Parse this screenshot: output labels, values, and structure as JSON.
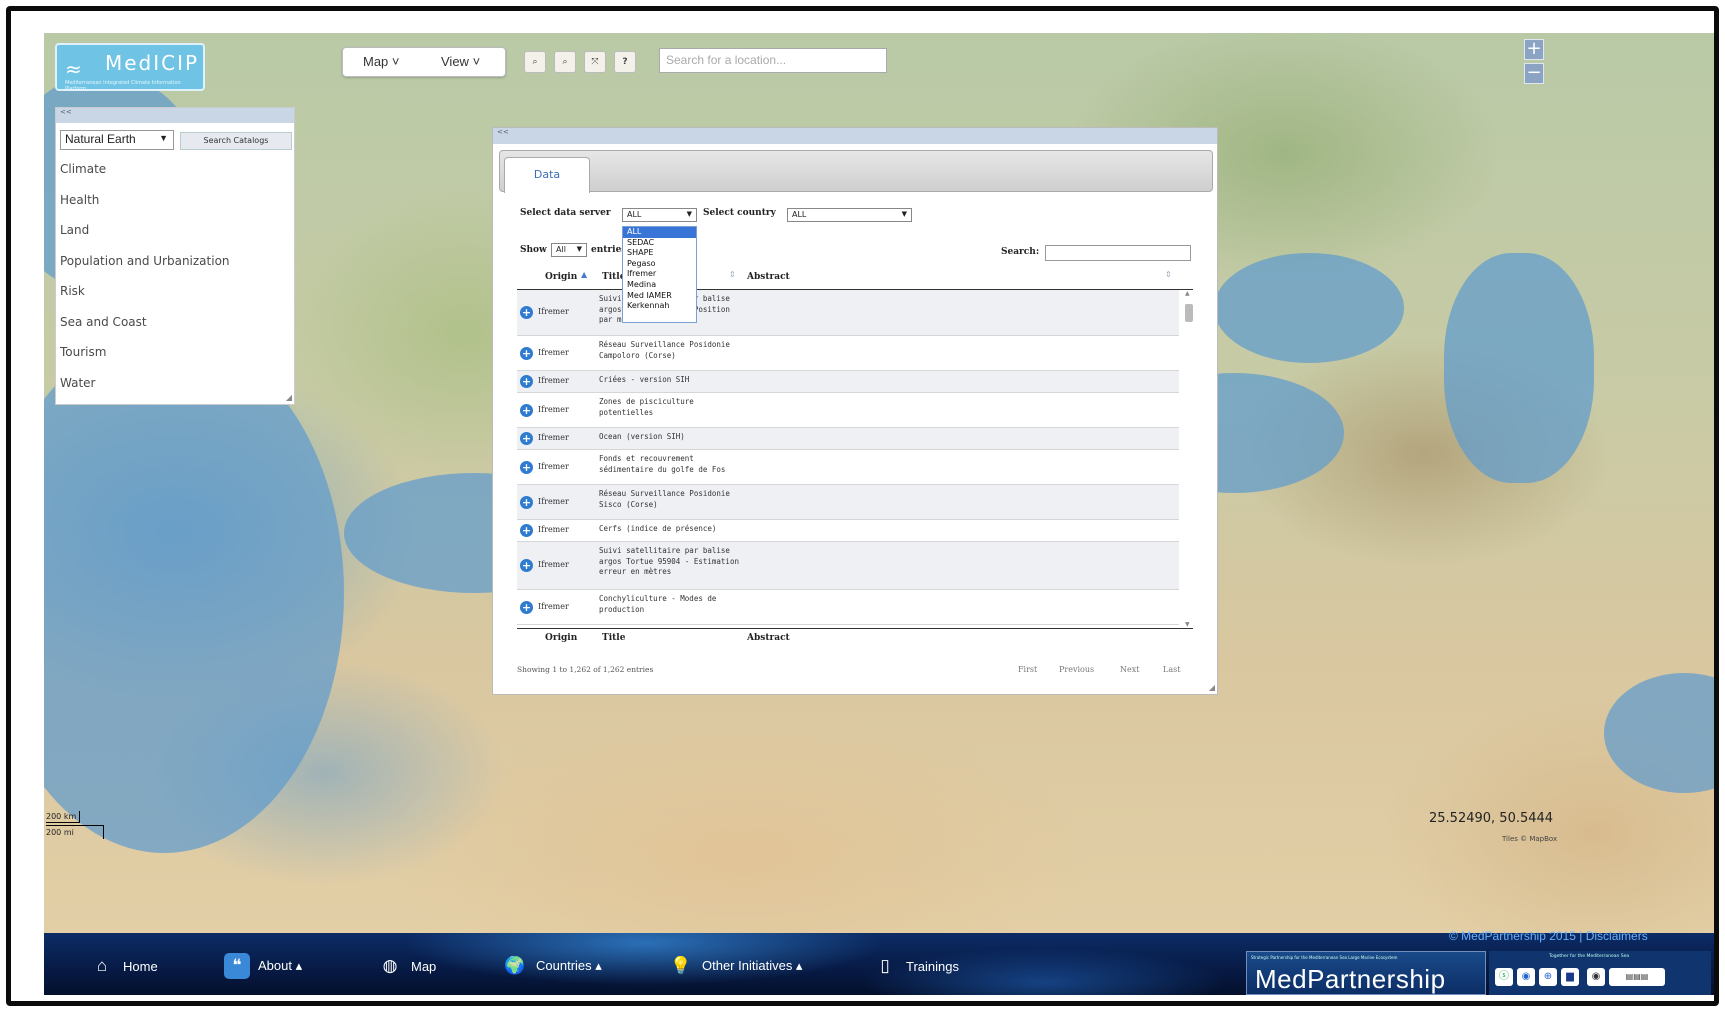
{
  "logo": {
    "name": "MedICIP",
    "tagline": "Mediterranean Integrated Climate Information Platform"
  },
  "toolbar": {
    "menus": [
      {
        "label": "Map"
      },
      {
        "label": "View"
      }
    ],
    "tools": [
      "zoom-in-tool-icon",
      "zoom-out-tool-icon",
      "full-extent-icon",
      "help-icon"
    ],
    "help_label": "?",
    "location_placeholder": "Search for a location..."
  },
  "zoom": {
    "in": "+",
    "out": "−"
  },
  "catalog_panel": {
    "collapse": "<<",
    "selected_source": "Natural Earth",
    "search_button": "Search Catalogs",
    "categories": [
      "Climate",
      "Health",
      "Land",
      "Population and Urbanization",
      "Risk",
      "Sea and Coast",
      "Tourism",
      "Water"
    ]
  },
  "data_panel": {
    "collapse": "<<",
    "tab": "Data",
    "server_label": "Select data server",
    "server_value": "ALL",
    "country_label": "Select country",
    "country_value": "ALL",
    "show_label": "Show",
    "show_value": "All",
    "entries_label": "entries",
    "search_label": "Search:",
    "server_options": [
      "ALL",
      "SEDAC",
      "SHAPE",
      "Pegaso",
      "Ifremer",
      "Medina",
      "Med IAMER",
      "Kerkennah"
    ],
    "columns": [
      "Origin",
      "Title",
      "Abstract"
    ],
    "rows": [
      {
        "origin": "Ifremer",
        "title": "Suivi satellitaire par balise argos Tortue 95904 - Position par mois"
      },
      {
        "origin": "Ifremer",
        "title": "Réseau Surveillance Posidonie Campoloro (Corse)"
      },
      {
        "origin": "Ifremer",
        "title": "Criées - version SIH"
      },
      {
        "origin": "Ifremer",
        "title": "Zones de pisciculture potentielles"
      },
      {
        "origin": "Ifremer",
        "title": "Ocean (version SIH)"
      },
      {
        "origin": "Ifremer",
        "title": "Fonds et recouvrement sédimentaire du golfe de Fos"
      },
      {
        "origin": "Ifremer",
        "title": "Réseau Surveillance Posidonie Sisco (Corse)"
      },
      {
        "origin": "Ifremer",
        "title": "Cerfs (indice de présence)"
      },
      {
        "origin": "Ifremer",
        "title": "Suivi satellitaire par balise argos Tortue 95904 - Estimation erreur en mètres"
      },
      {
        "origin": "Ifremer",
        "title": "Conchyliculture - Modes de production"
      }
    ],
    "info": "Showing 1 to 1,262 of 1,262 entries",
    "pagination": [
      "First",
      "Previous",
      "Next",
      "Last"
    ]
  },
  "scale": {
    "km": "200 km",
    "mi": "200 mi"
  },
  "coordinates": "25.52490, 50.5444",
  "tiles_credit": "Tiles © MapBox",
  "nav": {
    "items": [
      {
        "label": "Home",
        "icon": "home-icon"
      },
      {
        "label": "About ▴",
        "icon": "quote-icon"
      },
      {
        "label": "Map",
        "icon": "globe-icon"
      },
      {
        "label": "Countries ▴",
        "icon": "world-icon"
      },
      {
        "label": "Other Initiatives ▴",
        "icon": "lightbulb-icon"
      },
      {
        "label": "Trainings",
        "icon": "clipboard-icon"
      }
    ]
  },
  "footer": {
    "copyright": "© MedPartnership 2015 | Disclaimers",
    "brand_tagline": "Strategic Partnership for the Mediterranean Sea Large Marine Ecosystem",
    "brand": "MedPartnership",
    "partners_tagline": "Together for the Mediterranean Sea"
  }
}
